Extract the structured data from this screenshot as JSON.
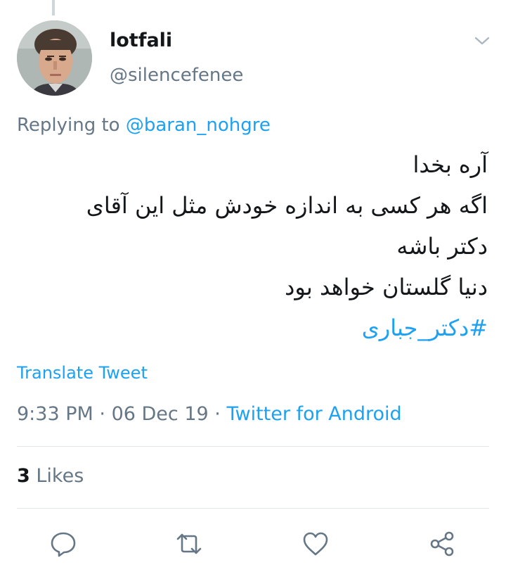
{
  "tweet": {
    "name": "lotfali",
    "handle": "@silencefenee",
    "replying_prefix": "Replying to ",
    "replying_to": "@baran_nohgre",
    "lines": [
      "آره بخدا",
      "اگه هر کسی به اندازه خودش مثل این آقای",
      "دکتر باشه",
      "دنیا گلستان خواهد بود"
    ],
    "hashtag": "#دکتر_جباری",
    "translate_label": "Translate Tweet",
    "time": "9:33 PM",
    "date": "06 Dec 19",
    "separator": "·",
    "source": "Twitter for Android",
    "likes_count": "3",
    "likes_label": " Likes"
  },
  "actions": [
    {
      "name": "reply",
      "icon": "reply-icon"
    },
    {
      "name": "retweet",
      "icon": "retweet-icon"
    },
    {
      "name": "like",
      "icon": "heart-icon"
    },
    {
      "name": "share",
      "icon": "share-icon"
    }
  ],
  "colors": {
    "accent": "#1da1f2",
    "secondary_text": "#657786",
    "divider": "#e1e8ed",
    "icon": "#657786"
  }
}
